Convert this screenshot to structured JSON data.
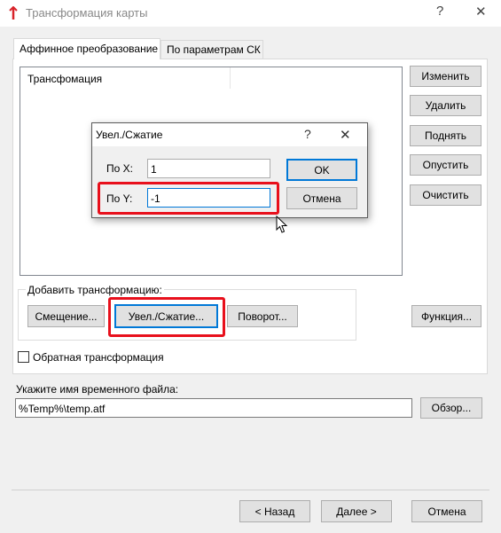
{
  "window": {
    "title": "Трансформация карты",
    "help_glyph": "?",
    "close_glyph": "✕",
    "app_icon": "red-tool-icon"
  },
  "tabs": [
    {
      "label": "Аффинное преобразование",
      "active": true
    },
    {
      "label": "По параметрам СК",
      "active": false
    }
  ],
  "list": {
    "column_header": "Трансфомация"
  },
  "side_buttons": {
    "edit": "Изменить",
    "delete": "Удалить",
    "up": "Поднять",
    "down": "Опустить",
    "clear": "Очистить"
  },
  "add_group": {
    "label": "Добавить трансформацию:",
    "shift": "Смещение...",
    "scale": "Увел./Сжатие...",
    "rotate": "Поворот...",
    "function": "Функция..."
  },
  "inverse": {
    "label": "Обратная трансформация",
    "checked": false
  },
  "temp_file": {
    "label": "Укажите имя временного файла:",
    "value": "%Temp%\\temp.atf",
    "browse": "Обзор..."
  },
  "nav": {
    "back": "< Назад",
    "next": "Далее >",
    "cancel": "Отмена"
  },
  "dialog": {
    "title": "Увел./Сжатие",
    "help_glyph": "?",
    "close_glyph": "✕",
    "x_label": "По X:",
    "x_value": "1",
    "y_label": "По Y:",
    "y_value": "-1",
    "ok": "OK",
    "cancel": "Отмена"
  },
  "colors": {
    "highlight": "#e8101c",
    "focus": "#0078d7",
    "window_bg": "#f0f0f0"
  }
}
